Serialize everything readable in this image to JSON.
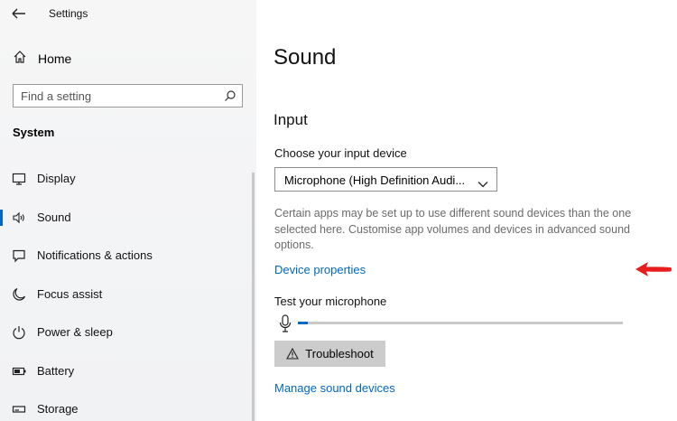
{
  "app": {
    "title": "Settings"
  },
  "sidebar": {
    "home_label": "Home",
    "search_placeholder": "Find a setting",
    "section": "System",
    "items": [
      {
        "label": "Display",
        "icon": "monitor-icon",
        "active": false
      },
      {
        "label": "Sound",
        "icon": "speaker-icon",
        "active": true
      },
      {
        "label": "Notifications & actions",
        "icon": "notification-icon",
        "active": false
      },
      {
        "label": "Focus assist",
        "icon": "moon-icon",
        "active": false
      },
      {
        "label": "Power & sleep",
        "icon": "power-icon",
        "active": false
      },
      {
        "label": "Battery",
        "icon": "battery-icon",
        "active": false
      },
      {
        "label": "Storage",
        "icon": "storage-icon",
        "active": false
      }
    ]
  },
  "main": {
    "title": "Sound",
    "input_heading": "Input",
    "choose_device_label": "Choose your input device",
    "selected_device": "Microphone (High Definition Audi...",
    "description": "Certain apps may be set up to use different sound devices than the one selected here. Customise app volumes and devices in advanced sound options.",
    "device_properties_link": "Device properties",
    "test_label": "Test your microphone",
    "mic_level": 0.03,
    "troubleshoot_label": "Troubleshoot",
    "manage_devices_link": "Manage sound devices"
  },
  "colors": {
    "accent": "#0067c0",
    "arrow": "#e81c1c"
  }
}
